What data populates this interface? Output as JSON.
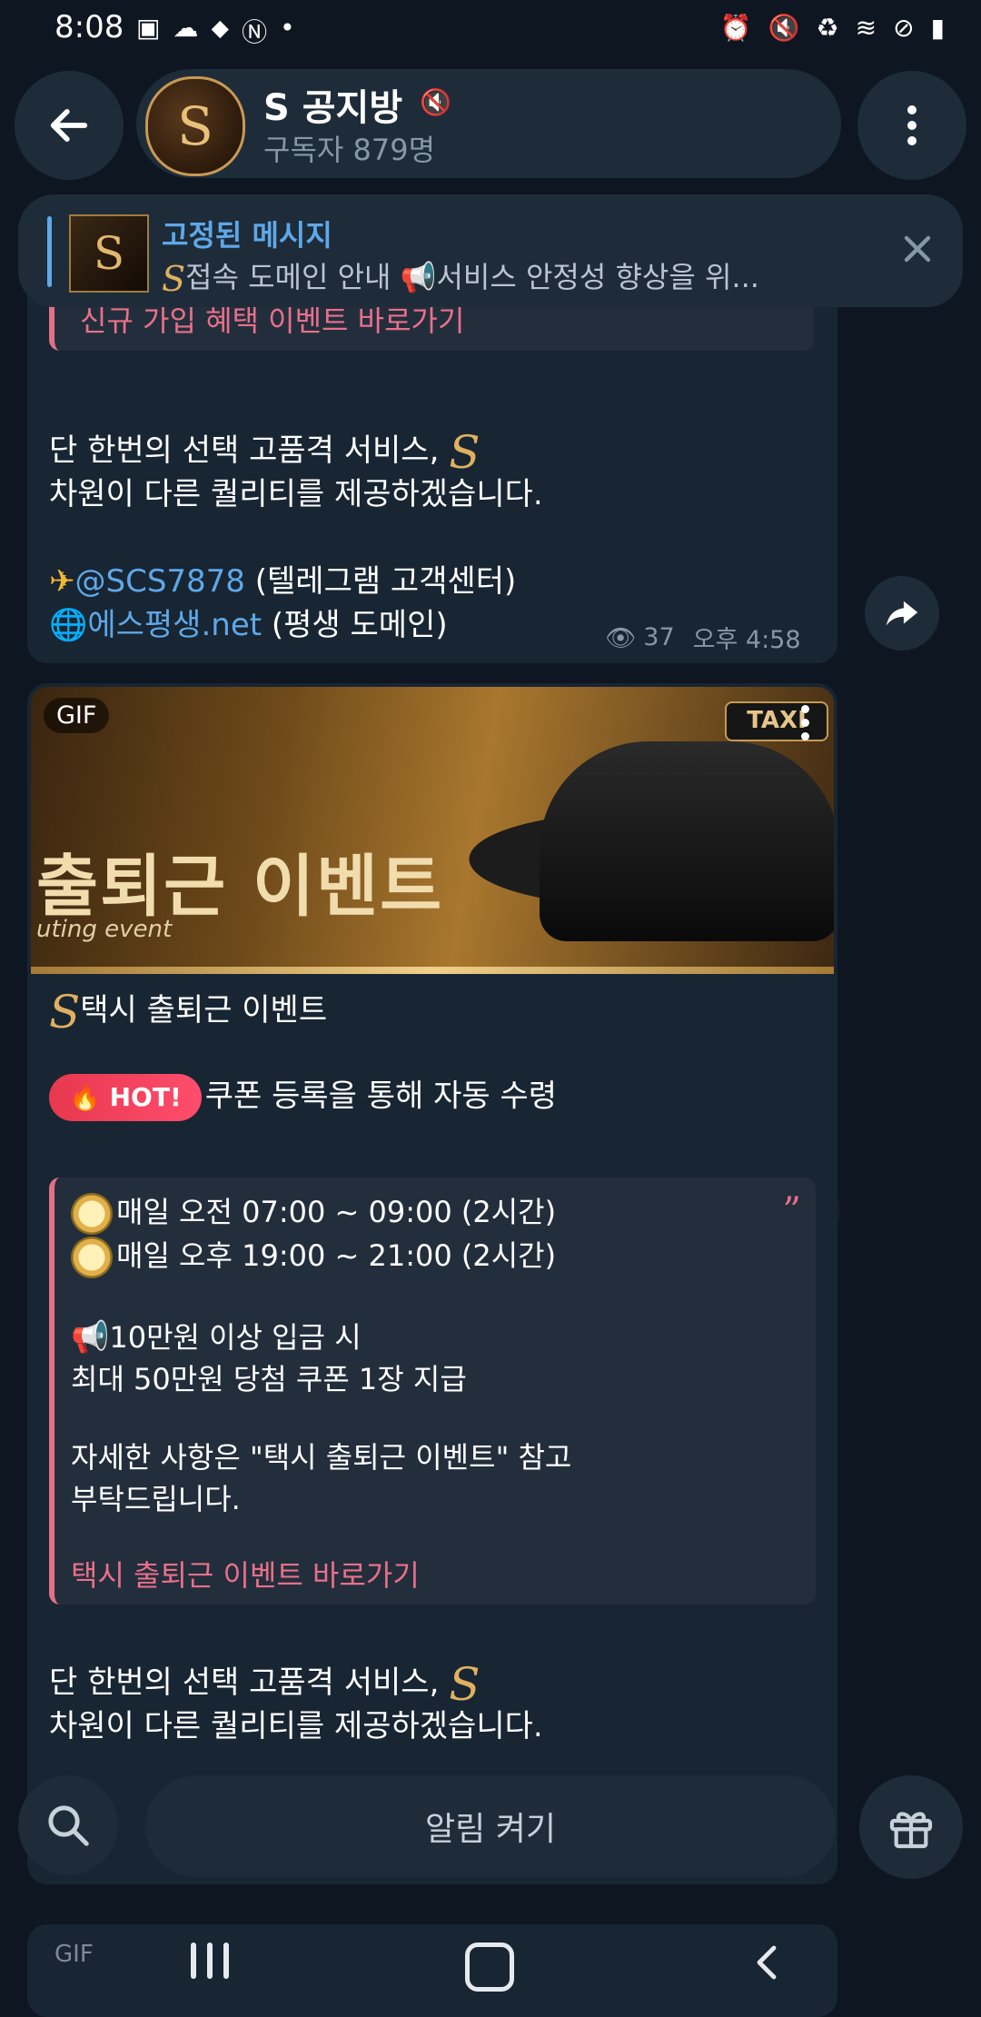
{
  "status_bar": {
    "time": "8:08",
    "left_icons": [
      "gallery-icon",
      "weather-icon",
      "location-icon",
      "n-icon",
      "dot-icon"
    ],
    "right_icons": [
      "alarm-icon",
      "mute-icon",
      "battery-saver-icon",
      "wifi-icon",
      "dnd-icon",
      "battery-icon"
    ]
  },
  "header": {
    "avatar_letter": "S",
    "channel_name": "S 공지방",
    "subscribers": "구독자 879명"
  },
  "pinned": {
    "title": "고정된 메시지",
    "text": "접속 도메인 안내  📢서비스 안정성 향상을 위..."
  },
  "message1": {
    "quote_link": "신규 가입 혜택 이벤트 바로가기",
    "line1": "단 한번의 선택 고품격 서비스,",
    "line2": "차원이 다른 퀄리티를 제공하겠습니다.",
    "telegram_handle": "@SCS7878",
    "telegram_label": " (텔레그램 고객센터)",
    "domain_link": "에스평생.net",
    "domain_label": " (평생 도메인)",
    "views": "37",
    "time": "오후 4:58"
  },
  "message2": {
    "gif_badge": "GIF",
    "gif_taxi": "TAXI",
    "gif_headline": "출퇴근 이벤트",
    "gif_sub": "uting event",
    "title": "택시 출퇴근 이벤트",
    "hot_label": "HOT!",
    "hot_text": "쿠폰 등록을 통해 자동 수령",
    "schedule1": "매일 오전 07:00 ~ 09:00 (2시간)",
    "schedule2": "매일 오후 19:00 ~ 21:00 (2시간)",
    "deposit_line": "10만원 이상 입금 시",
    "coupon_line": "최대 50만원 당첨 쿠폰 1장 지급",
    "detail1": "자세한 사항은 \"택시 출퇴근 이벤트\" 참고",
    "detail2": "부탁드립니다.",
    "quote_link": "택시 출퇴근 이벤트 바로가기",
    "line1": "단 한번의 선택 고품격 서비스,",
    "line2": "차원이 다른 퀄리티를 제공하겠습니다."
  },
  "bottom_bar": {
    "notify_label": "알림 켜기"
  },
  "peek": {
    "gif_badge": "GIF"
  },
  "colors": {
    "background": "#0e1621",
    "bubble": "#182533",
    "accent_blue": "#5fa8e8",
    "accent_pink": "#e9708a"
  }
}
